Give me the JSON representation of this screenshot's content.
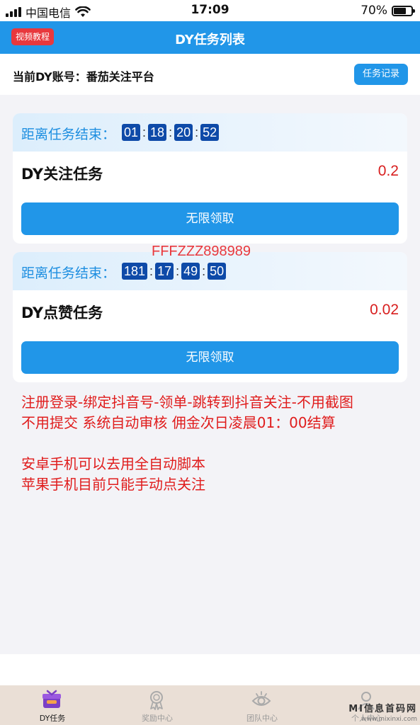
{
  "status_bar": {
    "carrier": "中国电信",
    "time": "17:09",
    "battery": "70%"
  },
  "header": {
    "tutorial_label": "视频教程",
    "title": "DY任务列表"
  },
  "account": {
    "text": "当前DY账号：番茄关注平台",
    "record_label": "任务记录"
  },
  "tasks": [
    {
      "countdown_label": "距离任务结束：",
      "countdown": [
        "01",
        "18",
        "20",
        "52"
      ],
      "name": "DY关注任务",
      "reward": "0.2",
      "button": "无限领取"
    },
    {
      "countdown_label": "距离任务结束：",
      "countdown": [
        "181",
        "17",
        "49",
        "50"
      ],
      "name": "DY点赞任务",
      "reward": "0.02",
      "button": "无限领取"
    }
  ],
  "promo_code": "FFFZZZ898989",
  "notes": {
    "line1": "注册登录-绑定抖音号-领单-跳转到抖音关注-不用截图",
    "line2": "不用提交 系统自动审核 佣金次日凌晨01：00结算",
    "line3": "安卓手机可以去用全自动脚本",
    "line4": "苹果手机目前只能手动点关注"
  },
  "tabbar": [
    {
      "label": "DY任务",
      "icon": "gift-box-icon",
      "active": true
    },
    {
      "label": "奖励中心",
      "icon": "award-medal-icon",
      "active": false
    },
    {
      "label": "团队中心",
      "icon": "eye-icon",
      "active": false
    },
    {
      "label": "个人中心",
      "icon": "user-icon",
      "active": false
    }
  ],
  "watermark": {
    "title": "MI信息首码网",
    "url": "www.mixinxi.com"
  },
  "colors": {
    "primary": "#2196e8",
    "danger": "#e8383d",
    "countdown_box": "#0e4aa8",
    "reward": "#d81e1e"
  }
}
